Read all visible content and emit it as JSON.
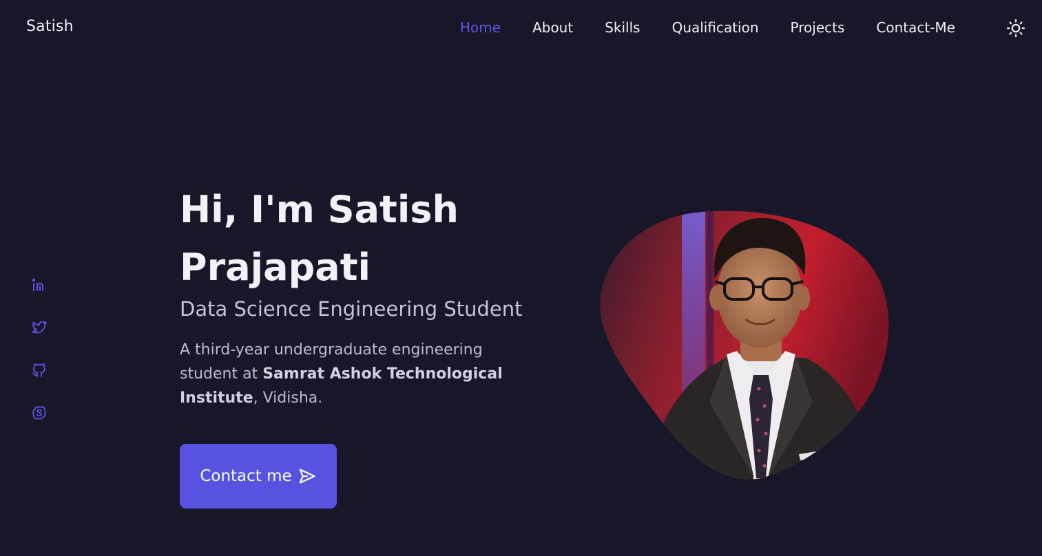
{
  "header": {
    "logo": "Satish",
    "nav": [
      {
        "label": "Home",
        "active": true
      },
      {
        "label": "About",
        "active": false
      },
      {
        "label": "Skills",
        "active": false
      },
      {
        "label": "Qualification",
        "active": false
      },
      {
        "label": "Projects",
        "active": false
      },
      {
        "label": "Contact-Me",
        "active": false
      }
    ],
    "theme_toggle_icon": "sun-icon"
  },
  "social": [
    {
      "icon": "linkedin-icon"
    },
    {
      "icon": "twitter-icon"
    },
    {
      "icon": "github-icon"
    },
    {
      "icon": "skype-icon"
    }
  ],
  "hero": {
    "title": "Hi, I'm Satish Prajapati",
    "subtitle": "Data Science Engineering Student",
    "description_prefix": "A third-year undergraduate engineering student at ",
    "institute": "Samrat Ashok Technological Institute",
    "description_suffix": ", Vidisha.",
    "cta_label": "Contact me",
    "cta_icon": "send-icon"
  },
  "colors": {
    "background": "#18172a",
    "accent": "#5753e0",
    "active_nav": "#5b55e6",
    "text": "#f2f1f7"
  }
}
